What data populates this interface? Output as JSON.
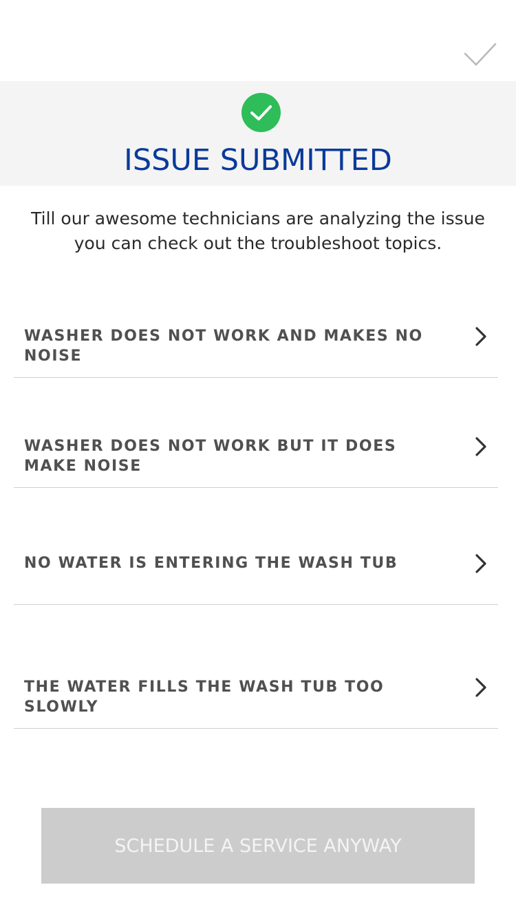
{
  "header": {
    "done_icon": "checkmark-icon"
  },
  "banner": {
    "status_icon": "check-circle-icon",
    "status_color": "#2ebd59",
    "title": "ISSUE SUBMITTED",
    "title_color": "#0a3a9a"
  },
  "message": {
    "line1": "Till our awesome technicians are analyzing the issue",
    "line2": "you can check out the troubleshoot topics."
  },
  "topics": [
    {
      "label": "WASHER DOES NOT WORK AND MAKES NO NOISE",
      "icon": "chevron-right-icon"
    },
    {
      "label": "WASHER DOES NOT WORK BUT IT DOES MAKE NOISE",
      "icon": "chevron-right-icon"
    },
    {
      "label": "NO WATER IS ENTERING THE WASH TUB",
      "icon": "chevron-right-icon"
    },
    {
      "label": "THE WATER FILLS THE WASH TUB TOO SLOWLY",
      "icon": "chevron-right-icon"
    }
  ],
  "actions": {
    "schedule_label": "SCHEDULE A SERVICE ANYWAY",
    "button_color": "#cccccc"
  }
}
